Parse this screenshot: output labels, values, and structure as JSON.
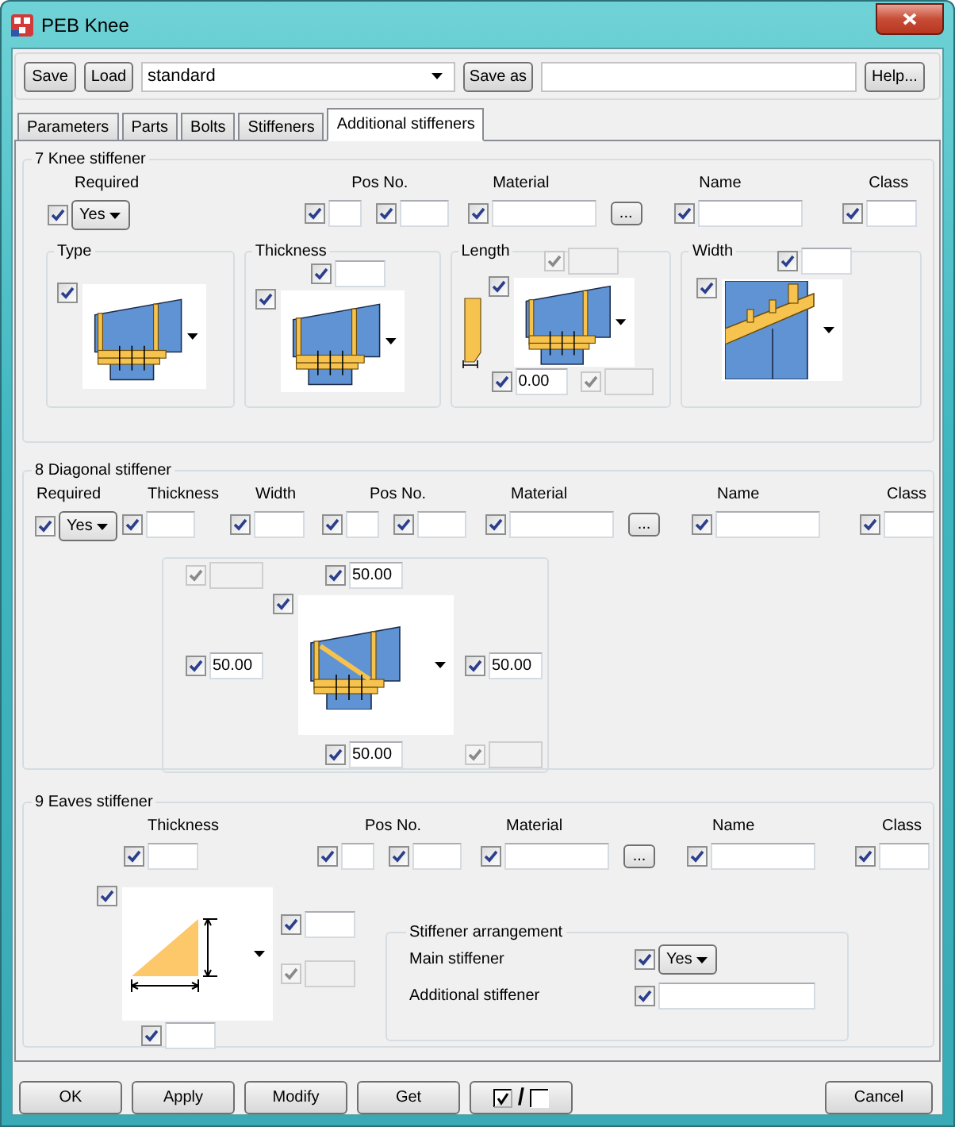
{
  "window": {
    "title": "PEB Knee"
  },
  "toolbar": {
    "save": "Save",
    "load": "Load",
    "preset": "standard",
    "save_as": "Save as",
    "help": "Help..."
  },
  "tabs": [
    {
      "label": "Parameters",
      "selected": false
    },
    {
      "label": "Parts",
      "selected": false
    },
    {
      "label": "Bolts",
      "selected": false
    },
    {
      "label": "Stiffeners",
      "selected": false
    },
    {
      "label": "Additional stiffeners",
      "selected": true
    }
  ],
  "knee_stiffener": {
    "title": "7 Knee stiffener",
    "groups": [
      {
        "label": "Required",
        "fields": [
          {
            "kind": "select",
            "checked": true,
            "disabled": false,
            "value": "Yes"
          }
        ]
      },
      {
        "label": "Pos No.",
        "fields": [
          {
            "kind": "input",
            "checked": true,
            "disabled": false
          },
          {
            "kind": "input",
            "checked": true,
            "disabled": false
          }
        ]
      },
      {
        "label": "Material",
        "fields": [
          {
            "kind": "input",
            "checked": true,
            "disabled": false
          },
          {
            "kind": "browse",
            "label": "..."
          }
        ]
      },
      {
        "label": "Name",
        "fields": [
          {
            "kind": "input",
            "checked": true,
            "disabled": false
          }
        ]
      },
      {
        "label": "Class",
        "fields": [
          {
            "kind": "input",
            "checked": true,
            "disabled": false
          }
        ]
      }
    ],
    "options": {
      "type": {
        "label": "Type",
        "picture": {
          "checked": true,
          "disabled": false
        }
      },
      "thickness": {
        "label": "Thickness",
        "field": {
          "kind": "input",
          "checked": true,
          "disabled": false
        },
        "picture": {
          "checked": true,
          "disabled": false
        }
      },
      "length": {
        "label": "Length",
        "top": {
          "kind": "input",
          "checked": true,
          "disabled": true
        },
        "picture": {
          "checked": true,
          "disabled": false
        },
        "bottom": {
          "kind": "input",
          "checked": true,
          "disabled": false,
          "value": "0.00"
        },
        "bottom_right": {
          "kind": "input",
          "checked": true,
          "disabled": true
        }
      },
      "width": {
        "label": "Width",
        "field": {
          "kind": "input",
          "checked": true,
          "disabled": false
        },
        "picture": {
          "checked": true,
          "disabled": false
        }
      }
    }
  },
  "diagonal_stiffener": {
    "title": "8 Diagonal stiffener",
    "groups": [
      {
        "label": "Required",
        "fields": [
          {
            "kind": "select",
            "checked": true,
            "disabled": false,
            "value": "Yes"
          }
        ]
      },
      {
        "label": "Thickness",
        "fields": [
          {
            "kind": "input",
            "checked": true,
            "disabled": false
          }
        ]
      },
      {
        "label": "Width",
        "fields": [
          {
            "kind": "input",
            "checked": true,
            "disabled": false
          }
        ]
      },
      {
        "label": "Pos No.",
        "fields": [
          {
            "kind": "input",
            "checked": true,
            "disabled": false
          },
          {
            "kind": "input",
            "checked": true,
            "disabled": false
          }
        ]
      },
      {
        "label": "Material",
        "fields": [
          {
            "kind": "input",
            "checked": true,
            "disabled": false
          },
          {
            "kind": "browse",
            "label": "..."
          }
        ]
      },
      {
        "label": "Name",
        "fields": [
          {
            "kind": "input",
            "checked": true,
            "disabled": false
          }
        ]
      },
      {
        "label": "Class",
        "fields": [
          {
            "kind": "input",
            "checked": true,
            "disabled": false
          }
        ]
      }
    ],
    "figure": {
      "top_left": {
        "kind": "input",
        "checked": true,
        "disabled": true
      },
      "top": {
        "kind": "input",
        "checked": true,
        "disabled": false,
        "value": "50.00"
      },
      "picture": {
        "checked": true,
        "disabled": false
      },
      "left": {
        "kind": "input",
        "checked": true,
        "disabled": false,
        "value": "50.00"
      },
      "right": {
        "kind": "input",
        "checked": true,
        "disabled": false,
        "value": "50.00"
      },
      "bottom": {
        "kind": "input",
        "checked": true,
        "disabled": false,
        "value": "50.00"
      },
      "bottom_right": {
        "kind": "input",
        "checked": true,
        "disabled": true
      }
    }
  },
  "eaves_stiffener": {
    "title": "9 Eaves stiffener",
    "groups": [
      {
        "label": "Thickness",
        "fields": [
          {
            "kind": "input",
            "checked": true,
            "disabled": false
          }
        ]
      },
      {
        "label": "Pos No.",
        "fields": [
          {
            "kind": "input",
            "checked": true,
            "disabled": false
          },
          {
            "kind": "input",
            "checked": true,
            "disabled": false
          }
        ]
      },
      {
        "label": "Material",
        "fields": [
          {
            "kind": "input",
            "checked": true,
            "disabled": false
          },
          {
            "kind": "browse",
            "label": "..."
          }
        ]
      },
      {
        "label": "Name",
        "fields": [
          {
            "kind": "input",
            "checked": true,
            "disabled": false
          }
        ]
      },
      {
        "label": "Class",
        "fields": [
          {
            "kind": "input",
            "checked": true,
            "disabled": false
          }
        ]
      }
    ],
    "figure": {
      "picture": {
        "checked": true,
        "disabled": false
      },
      "right_top": {
        "kind": "input",
        "checked": true,
        "disabled": false
      },
      "right_bottom": {
        "kind": "input",
        "checked": true,
        "disabled": true
      },
      "bottom": {
        "kind": "input",
        "checked": true,
        "disabled": false
      }
    },
    "arrangement": {
      "title": "Stiffener arrangement",
      "rows": [
        {
          "label": "Main stiffener",
          "field": {
            "kind": "select",
            "checked": true,
            "disabled": false,
            "value": "Yes"
          }
        },
        {
          "label": "Additional stiffener",
          "field": {
            "kind": "input",
            "checked": true,
            "disabled": false
          }
        }
      ]
    }
  },
  "footer": [
    {
      "kind": "text",
      "label": "OK"
    },
    {
      "kind": "text",
      "label": "Apply"
    },
    {
      "kind": "text",
      "label": "Modify"
    },
    {
      "kind": "text",
      "label": "Get"
    },
    {
      "kind": "toggle",
      "label": "/"
    },
    {
      "kind": "text",
      "label": "Cancel"
    }
  ]
}
